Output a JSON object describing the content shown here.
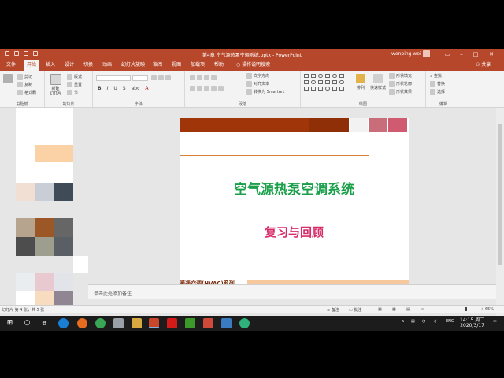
{
  "window": {
    "title": "第4章 空气源热泵空调系统.pptx  -  PowerPoint",
    "user": "wenping wei",
    "share": "共享"
  },
  "tabs": [
    "文件",
    "开始",
    "插入",
    "设计",
    "切换",
    "动画",
    "幻灯片放映",
    "审阅",
    "视图",
    "加载项",
    "帮助"
  ],
  "tell_me": "操作说明搜索",
  "ribbon": {
    "clipboard": {
      "label": "剪贴板",
      "items": [
        "剪切",
        "复制",
        "格式刷"
      ]
    },
    "slides": {
      "label": "幻灯片",
      "new_slide": "新建\n幻灯片",
      "items": [
        "版式",
        "重置",
        "节"
      ]
    },
    "font": {
      "label": "字体"
    },
    "paragraph": {
      "label": "段落",
      "items": [
        "文字方向",
        "对齐文本",
        "转换为 SmartArt"
      ]
    },
    "drawing": {
      "label": "绘图",
      "arrange": "排列",
      "styles": "快速样式",
      "items": [
        "形状填充",
        "形状轮廓",
        "形状效果"
      ]
    },
    "editing": {
      "label": "编辑",
      "items": [
        "查找",
        "替换",
        "选择"
      ]
    }
  },
  "slide": {
    "title": "空气源热泵空调系统",
    "subtitle": "复习与回顾",
    "footer": "暖通空调(HVAC)系列"
  },
  "notes_placeholder": "单击此处添加备注",
  "status": {
    "left": "幻灯片 第 4 张，共 5 张",
    "notes": "备注",
    "comments": "批注",
    "zoom": "65%"
  },
  "taskbar": {
    "time": "14:15 周二",
    "date": "2020/3/17",
    "lang": "ENG"
  }
}
